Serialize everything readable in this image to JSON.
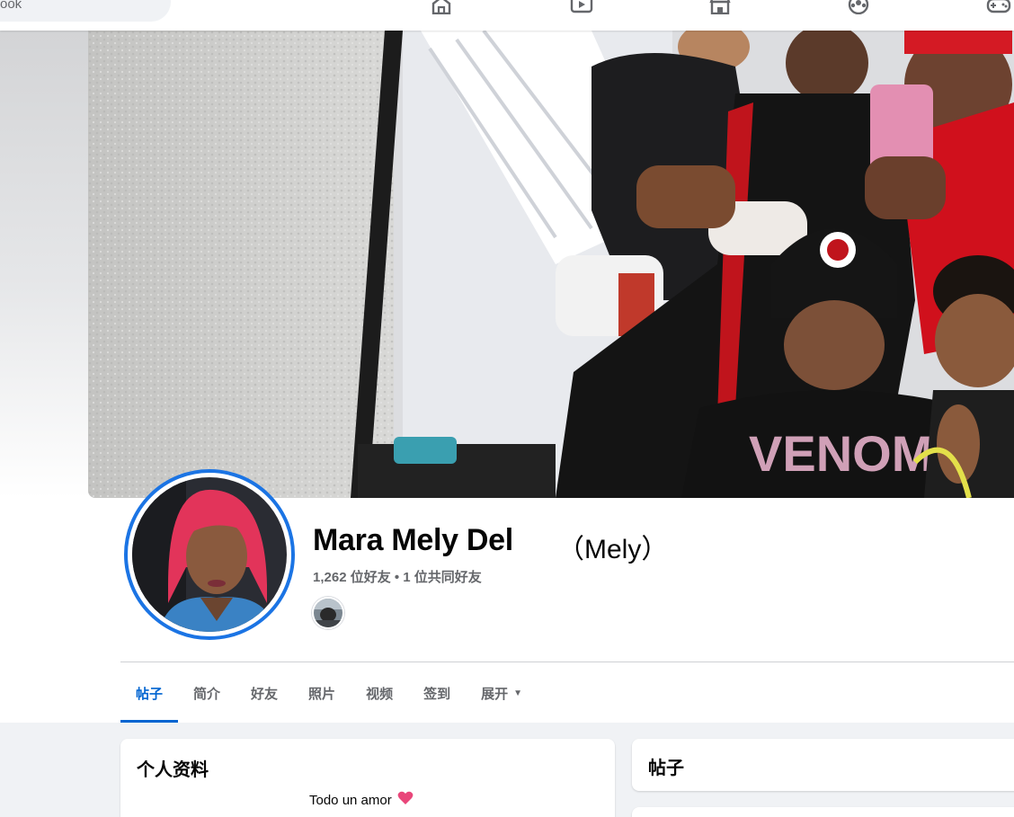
{
  "topbar": {
    "search_text": "ook",
    "nav_icons": [
      "home-icon",
      "watch-icon",
      "marketplace-icon",
      "groups-icon",
      "gaming-icon"
    ]
  },
  "profile": {
    "name": "Mara Mely Del",
    "alternate_name": "（Mely）",
    "friend_counts": "1,262 位好友 • 1 位共同好友"
  },
  "tabs": [
    {
      "label": "帖子",
      "active": true
    },
    {
      "label": "简介",
      "active": false
    },
    {
      "label": "好友",
      "active": false
    },
    {
      "label": "照片",
      "active": false
    },
    {
      "label": "视频",
      "active": false
    },
    {
      "label": "签到",
      "active": false
    },
    {
      "label": "展开",
      "active": false
    }
  ],
  "intro": {
    "title": "个人资料",
    "bio": "Todo un amor"
  },
  "posts": {
    "title": "帖子"
  },
  "colors": {
    "accent": "#0064d1",
    "ring": "#1b74e4",
    "secondary_text": "#65676b",
    "background": "#f0f2f5"
  }
}
